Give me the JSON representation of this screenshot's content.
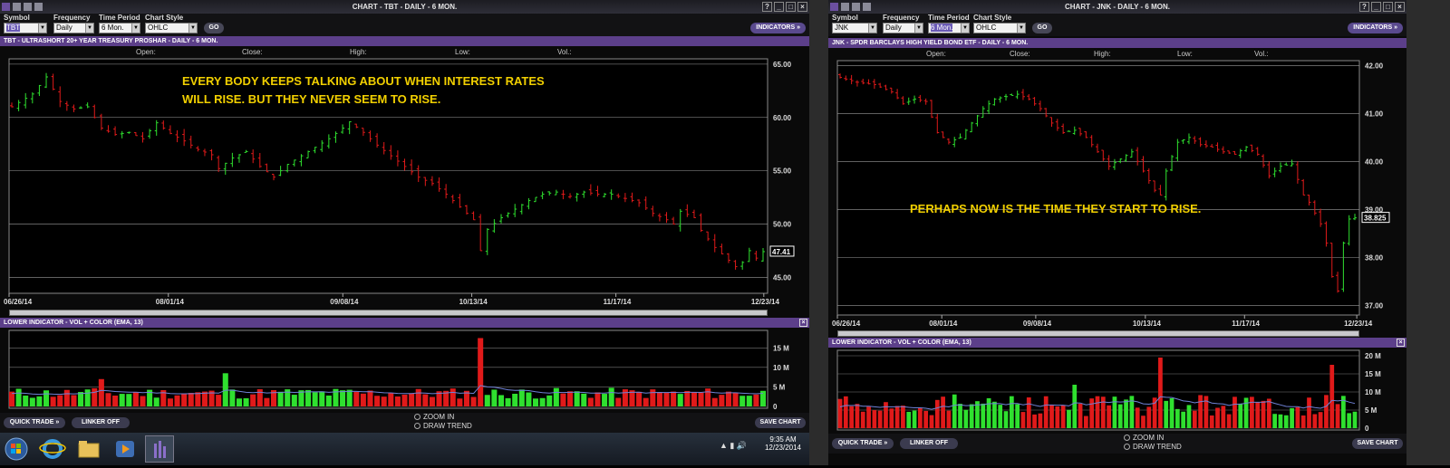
{
  "win1": {
    "title": "CHART - TBT - DAILY - 6 MON.",
    "labels": {
      "symbol": "Symbol",
      "frequency": "Frequency",
      "period": "Time Period",
      "style": "Chart Style"
    },
    "values": {
      "symbol": "TBT",
      "frequency": "Daily",
      "period": "6 Mon.",
      "style": "OHLC"
    },
    "go": "GO",
    "indicators": "INDICATORS »",
    "chart_header": "TBT - ULTRASHORT 20+ YEAR TREASURY PROSHAR - DAILY - 6 MON.",
    "ohlc": {
      "open": "Open:",
      "close": "Close:",
      "high": "High:",
      "low": "Low:",
      "vol": "Vol.:"
    },
    "annotation_line1": "EVERY BODY KEEPS TALKING ABOUT WHEN INTEREST RATES",
    "annotation_line2": "WILL RISE.  BUT THEY  NEVER SEEM TO RISE.",
    "y_ticks": [
      "65.00",
      "60.00",
      "55.00",
      "50.00",
      "45.00"
    ],
    "last_price": "47.41",
    "dates": [
      "06/26/14",
      "08/01/14",
      "09/08/14",
      "10/13/14",
      "11/17/14",
      "12/23/14"
    ],
    "lower_header": "LOWER INDICATOR - VOL + COLOR (EMA, 13)",
    "vol_ticks": [
      "15 M",
      "10 M",
      "5 M",
      "0"
    ],
    "quick_trade": "QUICK TRADE »",
    "linker": "LINKER OFF",
    "zoom_in": "ZOOM IN",
    "draw_trend": "DRAW TREND",
    "save_chart": "SAVE CHART"
  },
  "win2": {
    "title": "CHART - JNK - DAILY - 6 MON.",
    "labels": {
      "symbol": "Symbol",
      "frequency": "Frequency",
      "period": "Time Period",
      "style": "Chart Style"
    },
    "values": {
      "symbol": "JNK",
      "frequency": "Daily",
      "period": "6 Mon.",
      "style": "OHLC"
    },
    "go": "GO",
    "indicators": "INDICATORS »",
    "chart_header": "JNK - SPDR BARCLAYS HIGH YIELD BOND ETF - DAILY - 6 MON.",
    "ohlc": {
      "open": "Open:",
      "close": "Close:",
      "high": "High:",
      "low": "Low:",
      "vol": "Vol.:"
    },
    "annotation": "PERHAPS NOW IS THE TIME THEY START TO RISE.",
    "y_ticks": [
      "42.00",
      "41.00",
      "40.00",
      "39.00",
      "38.00",
      "37.00"
    ],
    "last_price": "38.825",
    "dates": [
      "06/26/14",
      "08/01/14",
      "09/08/14",
      "10/13/14",
      "11/17/14",
      "12/23/14"
    ],
    "lower_header": "LOWER INDICATOR - VOL + COLOR (EMA, 13)",
    "vol_ticks": [
      "20 M",
      "15 M",
      "10 M",
      "5 M",
      "0"
    ],
    "quick_trade": "QUICK TRADE »",
    "linker": "LINKER OFF",
    "zoom_in": "ZOOM IN",
    "draw_trend": "DRAW TREND",
    "save_chart": "SAVE CHART"
  },
  "taskbar": {
    "time": "9:35 AM",
    "date": "12/23/2014"
  },
  "colors": {
    "up": "#2fe02f",
    "down": "#e01a1a",
    "ema": "#6f82d6",
    "annotation": "#f2d000",
    "header": "#5c3f8a"
  },
  "chart_data": [
    {
      "type": "ohlc",
      "symbol": "TBT",
      "dates": [
        "06/26/14",
        "08/01/14",
        "09/08/14",
        "10/13/14",
        "11/17/14",
        "12/23/14"
      ],
      "ylim": [
        43.5,
        65.5
      ],
      "close_path": [
        [
          0,
          61
        ],
        [
          3,
          62.2
        ],
        [
          5,
          63.8
        ],
        [
          7,
          61.5
        ],
        [
          9,
          60.8
        ],
        [
          11,
          61
        ],
        [
          13,
          59
        ],
        [
          15,
          58.4
        ],
        [
          17,
          58.6
        ],
        [
          19,
          58
        ],
        [
          21,
          59.5
        ],
        [
          23,
          58.5
        ],
        [
          25,
          57.8
        ],
        [
          27,
          57
        ],
        [
          29,
          56.5
        ],
        [
          30,
          55.2
        ],
        [
          32,
          56.2
        ],
        [
          34,
          56.8
        ],
        [
          36,
          55.4
        ],
        [
          38,
          54.4
        ],
        [
          40,
          55.6
        ],
        [
          42,
          56.4
        ],
        [
          44,
          57.2
        ],
        [
          46,
          58
        ],
        [
          48,
          59
        ],
        [
          49,
          59.6
        ],
        [
          51,
          58.6
        ],
        [
          53,
          57.4
        ],
        [
          55,
          56.4
        ],
        [
          57,
          55.4
        ],
        [
          59,
          54.4
        ],
        [
          61,
          53.8
        ],
        [
          63,
          52.8
        ],
        [
          65,
          51.6
        ],
        [
          67,
          50.4
        ],
        [
          68,
          47.5
        ],
        [
          69,
          49.5
        ],
        [
          71,
          50.6
        ],
        [
          73,
          51.4
        ],
        [
          75,
          52.2
        ],
        [
          77,
          52.8
        ],
        [
          79,
          53
        ],
        [
          81,
          52.6
        ],
        [
          83,
          53
        ],
        [
          85,
          52.8
        ],
        [
          87,
          52.8
        ],
        [
          89,
          52.4
        ],
        [
          91,
          52
        ],
        [
          93,
          51
        ],
        [
          95,
          50.4
        ],
        [
          96,
          50
        ],
        [
          97,
          51.2
        ],
        [
          99,
          50.6
        ],
        [
          100,
          49.4
        ],
        [
          102,
          47.8
        ],
        [
          103,
          47.2
        ],
        [
          105,
          46
        ],
        [
          106,
          46.4
        ],
        [
          107,
          47.5
        ],
        [
          108,
          46.8
        ],
        [
          109,
          47.41
        ]
      ],
      "last": 47.41,
      "volume_ylim": [
        0,
        19
      ],
      "volume_tallest": [
        {
          "index": 68,
          "value": 17.5
        },
        {
          "index": 31,
          "value": 8.5
        },
        {
          "index": 13,
          "value": 7
        }
      ]
    },
    {
      "type": "ohlc",
      "symbol": "JNK",
      "dates": [
        "06/26/14",
        "08/01/14",
        "09/08/14",
        "10/13/14",
        "11/17/14",
        "12/23/14"
      ],
      "ylim": [
        36.8,
        42.1
      ],
      "close_path": [
        [
          0,
          41.75
        ],
        [
          3,
          41.65
        ],
        [
          6,
          41.6
        ],
        [
          9,
          41.45
        ],
        [
          11,
          41.2
        ],
        [
          13,
          41.3
        ],
        [
          15,
          41.25
        ],
        [
          17,
          40.6
        ],
        [
          19,
          40.4
        ],
        [
          21,
          40.5
        ],
        [
          23,
          40.8
        ],
        [
          25,
          41.1
        ],
        [
          27,
          41.3
        ],
        [
          29,
          41.35
        ],
        [
          31,
          41.4
        ],
        [
          33,
          41.3
        ],
        [
          35,
          41.1
        ],
        [
          37,
          40.8
        ],
        [
          39,
          40.6
        ],
        [
          41,
          40.65
        ],
        [
          43,
          40.5
        ],
        [
          45,
          40.2
        ],
        [
          47,
          39.9
        ],
        [
          49,
          40.05
        ],
        [
          51,
          40.2
        ],
        [
          53,
          39.8
        ],
        [
          55,
          39.4
        ],
        [
          56,
          39.3
        ],
        [
          57,
          39.8
        ],
        [
          59,
          40.4
        ],
        [
          61,
          40.5
        ],
        [
          63,
          40.35
        ],
        [
          65,
          40.3
        ],
        [
          67,
          40.2
        ],
        [
          69,
          40.15
        ],
        [
          71,
          40.3
        ],
        [
          73,
          40.15
        ],
        [
          75,
          39.7
        ],
        [
          77,
          39.9
        ],
        [
          79,
          39.95
        ],
        [
          81,
          39.3
        ],
        [
          82,
          39.15
        ],
        [
          84,
          38.7
        ],
        [
          85,
          38.3
        ],
        [
          86,
          37.6
        ],
        [
          87,
          37.3
        ],
        [
          88,
          38.3
        ],
        [
          89,
          38.8
        ],
        [
          90,
          38.825
        ]
      ],
      "last": 38.825,
      "volume_ylim": [
        0,
        21
      ],
      "volume_tallest": [
        {
          "index": 56,
          "value": 19.5
        },
        {
          "index": 86,
          "value": 17.5
        },
        {
          "index": 41,
          "value": 12
        }
      ]
    }
  ]
}
